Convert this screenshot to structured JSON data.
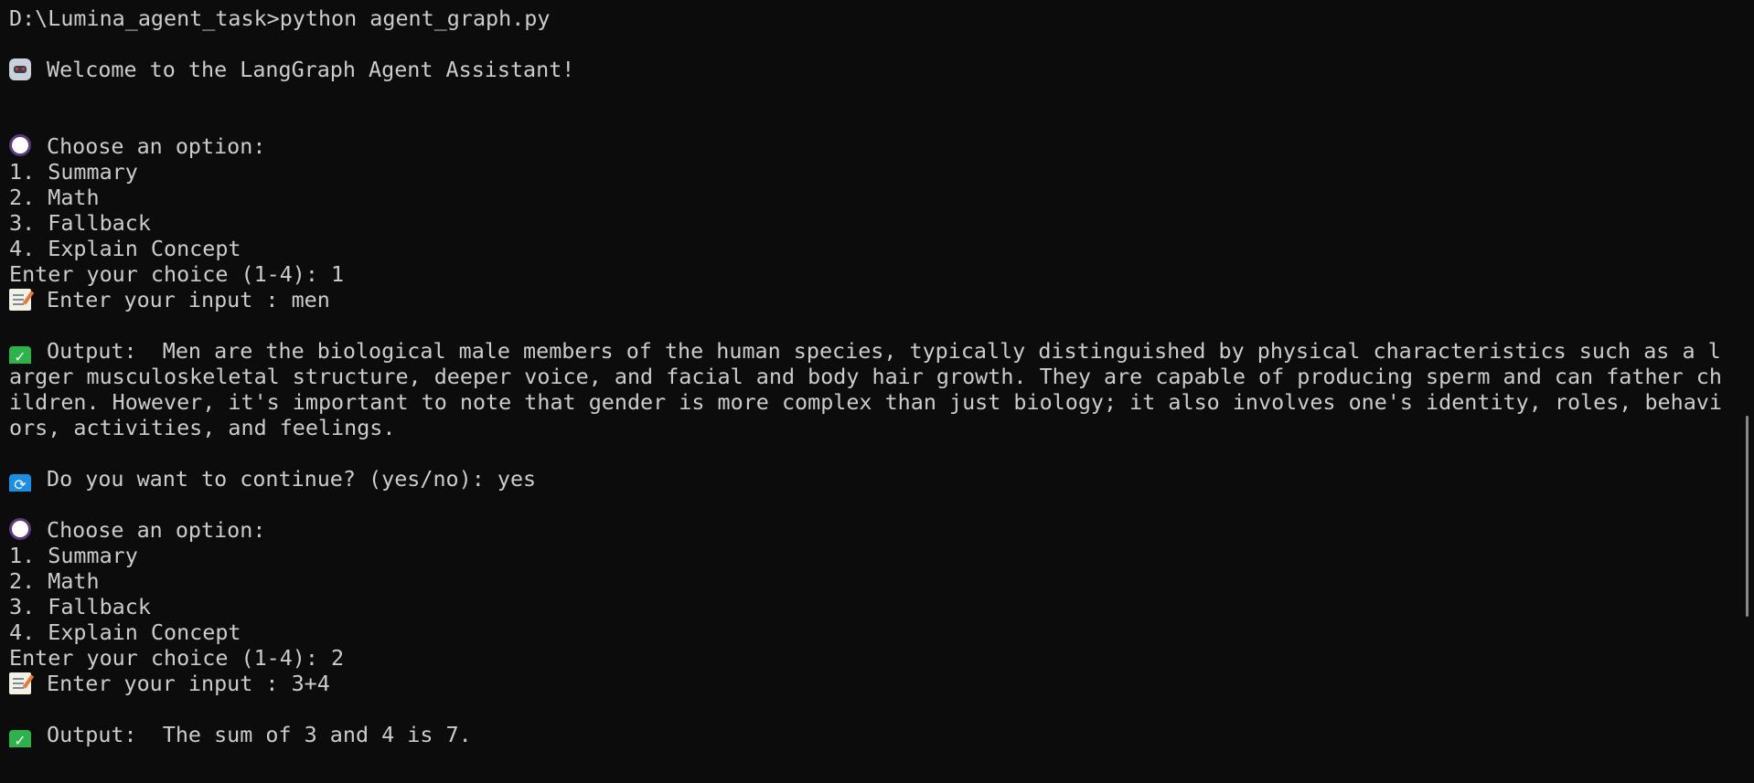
{
  "terminal": {
    "prompt_line": "D:\\Lumina_agent_task>python agent_graph.py",
    "welcome": "Welcome to the LangGraph Agent Assistant!",
    "session1": {
      "choose_label": "Choose an option:",
      "options": [
        "1. Summary",
        "2. Math",
        "3. Fallback",
        "4. Explain Concept"
      ],
      "choice_line": "Enter your choice (1-4): 1",
      "input_line": "Enter your input : men",
      "output_lines": [
        "Output:  Men are the biological male members of the human species, typically distinguished by physical characteristics such as a l",
        "arger musculoskeletal structure, deeper voice, and facial and body hair growth. They are capable of producing sperm and can father ch",
        "ildren. However, it's important to note that gender is more complex than just biology; it also involves one's identity, roles, behavi",
        "ors, activities, and feelings."
      ],
      "continue_line": "Do you want to continue? (yes/no): yes"
    },
    "session2": {
      "choose_label": "Choose an option:",
      "options": [
        "1. Summary",
        "2. Math",
        "3. Fallback",
        "4. Explain Concept"
      ],
      "choice_line": "Enter your choice (1-4): 2",
      "input_line": "Enter your input : 3+4",
      "output_line": "Output:  The sum of 3 and 4 is 7."
    },
    "icons": {
      "welcome": "robot-icon",
      "choose": "purple-circle-icon",
      "input": "memo-icon",
      "output": "check-mark-icon",
      "continue": "repeat-icon"
    },
    "colors": {
      "background": "#0c0c0c",
      "text": "#cccccc",
      "check": "#2fb24c",
      "repeat": "#1d8fe0"
    }
  }
}
